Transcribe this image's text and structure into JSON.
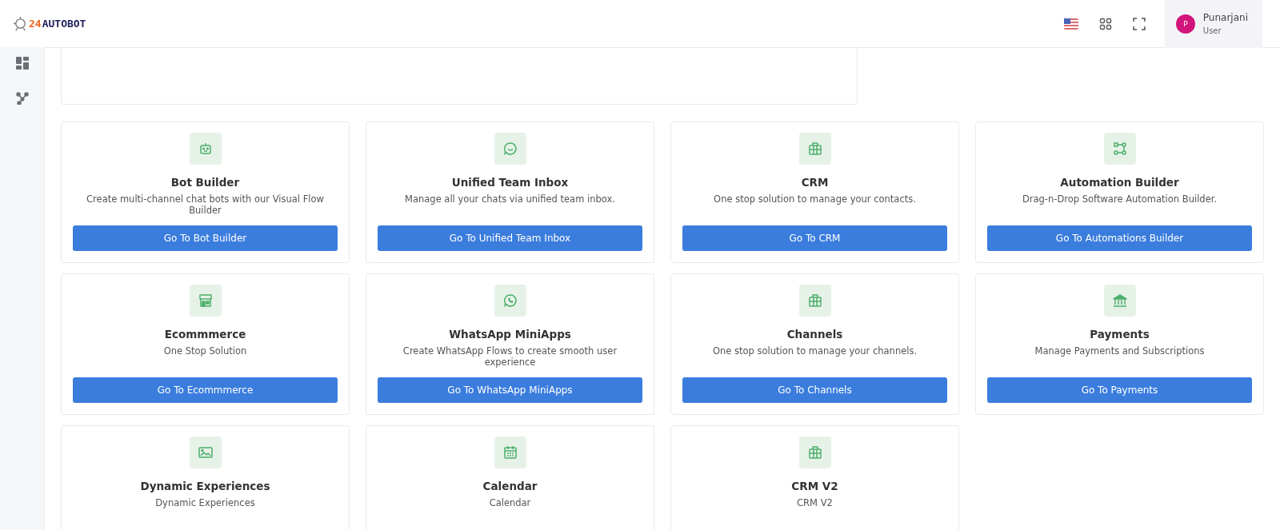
{
  "header": {
    "logo": {
      "number": "24",
      "word": "AUTOBOT"
    },
    "user": {
      "initial": "P",
      "name": "Punarjani",
      "role": "User"
    }
  },
  "cards": [
    {
      "title": "Bot Builder",
      "description": "Create multi-channel chat bots with our Visual Flow Builder",
      "button": "Go To Bot Builder"
    },
    {
      "title": "Unified Team Inbox",
      "description": "Manage all your chats via unified team inbox.",
      "button": "Go To Unified Team Inbox"
    },
    {
      "title": "CRM",
      "description": "One stop solution to manage your contacts.",
      "button": "Go To CRM"
    },
    {
      "title": "Automation Builder",
      "description": "Drag-n-Drop Software Automation Builder.",
      "button": "Go To Automations Builder"
    },
    {
      "title": "Ecommmerce",
      "description": "One Stop Solution",
      "button": "Go To Ecommmerce"
    },
    {
      "title": "WhatsApp MiniApps",
      "description": "Create WhatsApp Flows to create smooth user experience",
      "button": "Go To WhatsApp MiniApps"
    },
    {
      "title": "Channels",
      "description": "One stop solution to manage your channels.",
      "button": "Go To Channels"
    },
    {
      "title": "Payments",
      "description": "Manage Payments and Subscriptions",
      "button": "Go To Payments"
    },
    {
      "title": "Dynamic Experiences",
      "description": "Dynamic Experiences"
    },
    {
      "title": "Calendar",
      "description": "Calendar"
    },
    {
      "title": "CRM V2",
      "description": "CRM V2"
    }
  ]
}
